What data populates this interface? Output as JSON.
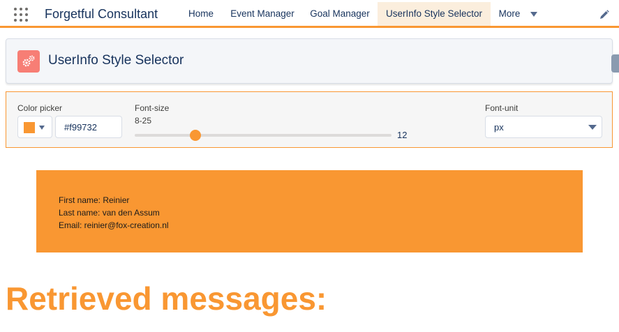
{
  "nav": {
    "app_name": "Forgetful Consultant",
    "tabs": [
      {
        "label": "Home"
      },
      {
        "label": "Event Manager"
      },
      {
        "label": "Goal Manager"
      },
      {
        "label": "UserInfo Style Selector"
      },
      {
        "label": "More"
      }
    ],
    "active_tab": "UserInfo Style Selector",
    "icons": {
      "app_launcher": "grid-icon",
      "more": "chevron-down-icon",
      "edit": "pencil-icon"
    }
  },
  "header": {
    "title": "UserInfo Style Selector",
    "icon": "gears-icon",
    "icon_color": "#f77e75"
  },
  "controls": {
    "color_picker": {
      "label": "Color picker",
      "value": "#f99732",
      "swatch_color": "#f99732"
    },
    "font_size": {
      "label": "Font-size",
      "range_label": "8-25",
      "min": 8,
      "max": 25,
      "value": 12,
      "value_text": "12"
    },
    "font_unit": {
      "label": "Font-unit",
      "selected": "px",
      "options": [
        "px"
      ]
    }
  },
  "userinfo": {
    "background": "#f99732",
    "first_name": "First name: Reinier",
    "last_name": "Last name: van den Assum",
    "email": "Email: reinier@fox-creation.nl"
  },
  "messages": {
    "heading": "Retrieved messages:",
    "color": "#f99732"
  },
  "theme": {
    "accent": "#f99732",
    "text": "#16325c"
  }
}
